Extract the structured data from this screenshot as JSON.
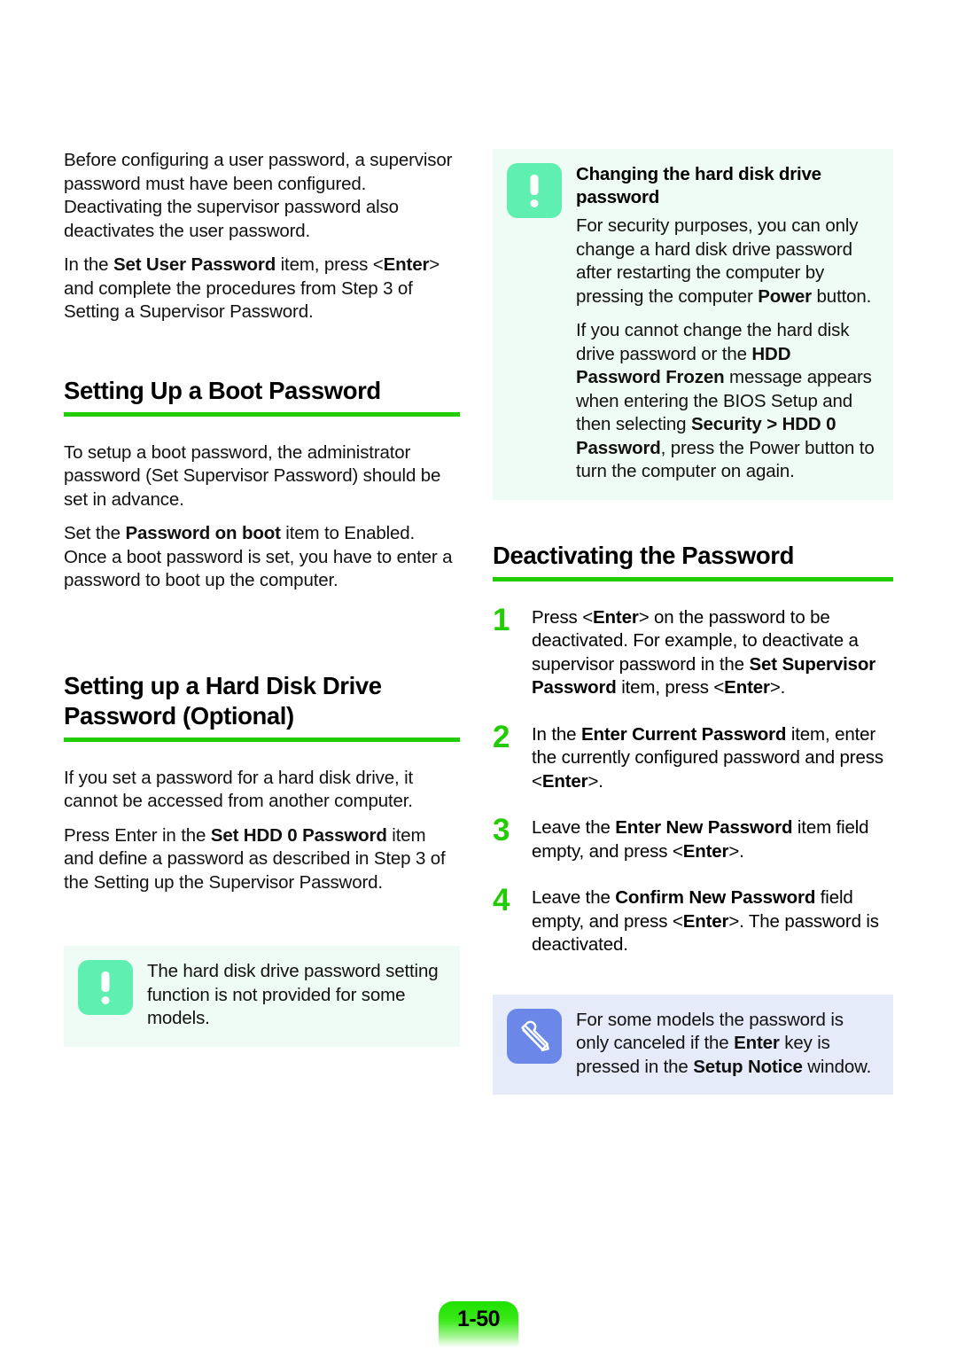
{
  "page": {
    "number_label": "1-50"
  },
  "left_column": {
    "intro": {
      "paragraph_1": "Before configuring a user password, a supervisor password must have been configured. Deactivating the supervisor password also deactivates the user password.",
      "paragraph_2_parts": [
        {
          "text": "In the ",
          "bold": false
        },
        {
          "text": "Set User Password",
          "bold": true
        },
        {
          "text": " item, press <",
          "bold": false
        },
        {
          "text": "Enter",
          "bold": true
        },
        {
          "text": "> and complete the procedures from Step 3 of Setting a Supervisor Password.",
          "bold": false
        }
      ]
    },
    "section_boot": {
      "heading": "Setting Up a Boot Password",
      "rule_color": "#22CC00",
      "paragraph_1": "To setup a boot password, the administrator password (Set Supervisor Password) should be set in advance.",
      "paragraph_2_parts": [
        {
          "text": "Set the ",
          "bold": false
        },
        {
          "text": "Password on boot",
          "bold": true
        },
        {
          "text": " item to Enabled. Once a boot password is set, you have to enter a password to boot up the computer.",
          "bold": false
        }
      ]
    },
    "section_hdd": {
      "heading": "Setting up a Hard Disk Drive Password (Optional)",
      "rule_color": "#22CC00",
      "paragraph_1": "If you set a password for a hard disk drive, it cannot be accessed from another computer.",
      "paragraph_2_parts": [
        {
          "text": "Press Enter in the ",
          "bold": false
        },
        {
          "text": "Set HDD 0 Password",
          "bold": true
        },
        {
          "text": " item and define a password as described in Step 3 of the Setting up the Supervisor Password.",
          "bold": false
        }
      ]
    },
    "notice": {
      "icon_name": "exclamation-icon",
      "icon_color": "#5FEFB0",
      "background": "#EFFCF5",
      "text": "The hard disk drive password setting function is not provided for some models."
    }
  },
  "right_column": {
    "notice": {
      "icon_name": "exclamation-icon",
      "icon_color": "#5FEFB0",
      "background": "#EFFCF5",
      "title": "Changing the hard disk drive password",
      "paragraph_1_parts": [
        {
          "text": "For security purposes, you can only change a hard disk drive password after restarting the computer by pressing the computer ",
          "bold": false
        },
        {
          "text": "Power",
          "bold": true
        },
        {
          "text": " button.",
          "bold": false
        }
      ],
      "paragraph_2_parts": [
        {
          "text": "If you cannot change the hard disk drive password or the ",
          "bold": false
        },
        {
          "text": "HDD Password Frozen",
          "bold": true
        },
        {
          "text": " message appears when entering the BIOS Setup and then selecting ",
          "bold": false
        },
        {
          "text": "Security > HDD 0 Password",
          "bold": true
        },
        {
          "text": ", press the Power button to turn the computer on again.",
          "bold": false
        }
      ]
    },
    "section_deactivate": {
      "heading": "Deactivating the Password",
      "rule_color": "#22CC00",
      "number_color": "#22CC00",
      "steps": [
        {
          "number": "1",
          "parts": [
            {
              "text": "Press <",
              "bold": false
            },
            {
              "text": "Enter",
              "bold": true
            },
            {
              "text": "> on the password to be deactivated. For example, to deactivate a supervisor password in the ",
              "bold": false
            },
            {
              "text": "Set Supervisor Password",
              "bold": true
            },
            {
              "text": " item, press <",
              "bold": false
            },
            {
              "text": "Enter",
              "bold": true
            },
            {
              "text": ">.",
              "bold": false
            }
          ]
        },
        {
          "number": "2",
          "parts": [
            {
              "text": "In the ",
              "bold": false
            },
            {
              "text": "Enter Current Password",
              "bold": true
            },
            {
              "text": " item, enter the currently configured password and press <",
              "bold": false
            },
            {
              "text": "Enter",
              "bold": true
            },
            {
              "text": ">.",
              "bold": false
            }
          ]
        },
        {
          "number": "3",
          "parts": [
            {
              "text": "Leave the ",
              "bold": false
            },
            {
              "text": "Enter New Password",
              "bold": true
            },
            {
              "text": " item field empty, and press <",
              "bold": false
            },
            {
              "text": "Enter",
              "bold": true
            },
            {
              "text": ">.",
              "bold": false
            }
          ]
        },
        {
          "number": "4",
          "parts": [
            {
              "text": "Leave the ",
              "bold": false
            },
            {
              "text": "Confirm New Password",
              "bold": true
            },
            {
              "text": " field empty, and press <",
              "bold": false
            },
            {
              "text": "Enter",
              "bold": true
            },
            {
              "text": ">. The password is deactivated.",
              "bold": false
            }
          ]
        }
      ]
    },
    "note": {
      "icon_name": "pencil-icon",
      "icon_color": "#6B87E8",
      "background": "#E6EBFA",
      "parts": [
        {
          "text": "For some models the password is only canceled if the ",
          "bold": false
        },
        {
          "text": "Enter",
          "bold": true
        },
        {
          "text": " key is pressed in the ",
          "bold": false
        },
        {
          "text": "Setup Notice",
          "bold": true
        },
        {
          "text": " window.",
          "bold": false
        }
      ]
    }
  }
}
